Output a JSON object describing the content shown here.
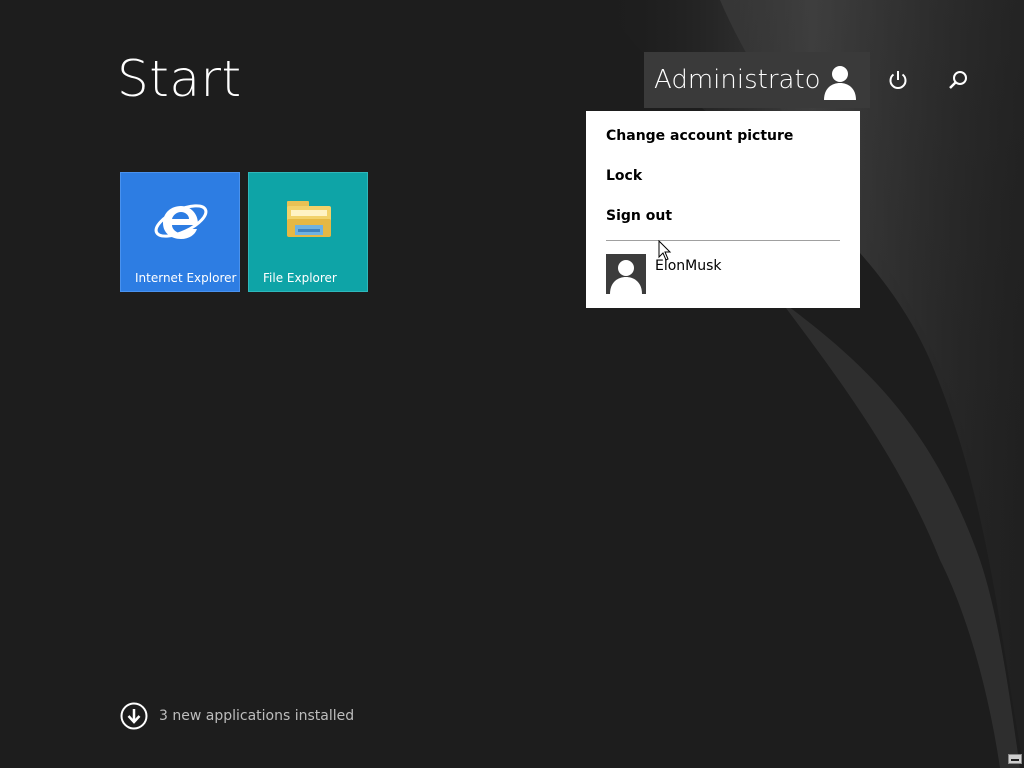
{
  "start": {
    "title": "Start"
  },
  "account": {
    "name": "Administrator",
    "menu": {
      "change_picture": "Change account picture",
      "lock": "Lock",
      "sign_out": "Sign out",
      "other_user": "ElonMusk"
    }
  },
  "tiles": [
    {
      "label": "Internet Explorer",
      "icon": "internet-explorer-icon",
      "color": "#2d7de3"
    },
    {
      "label": "File Explorer",
      "icon": "file-explorer-icon",
      "color": "#0ea4a7"
    }
  ],
  "notice": {
    "text": "3 new applications installed"
  },
  "icons": {
    "power": "power-icon",
    "search": "search-icon",
    "user": "user-avatar-icon",
    "download": "down-arrow-circle-icon"
  }
}
